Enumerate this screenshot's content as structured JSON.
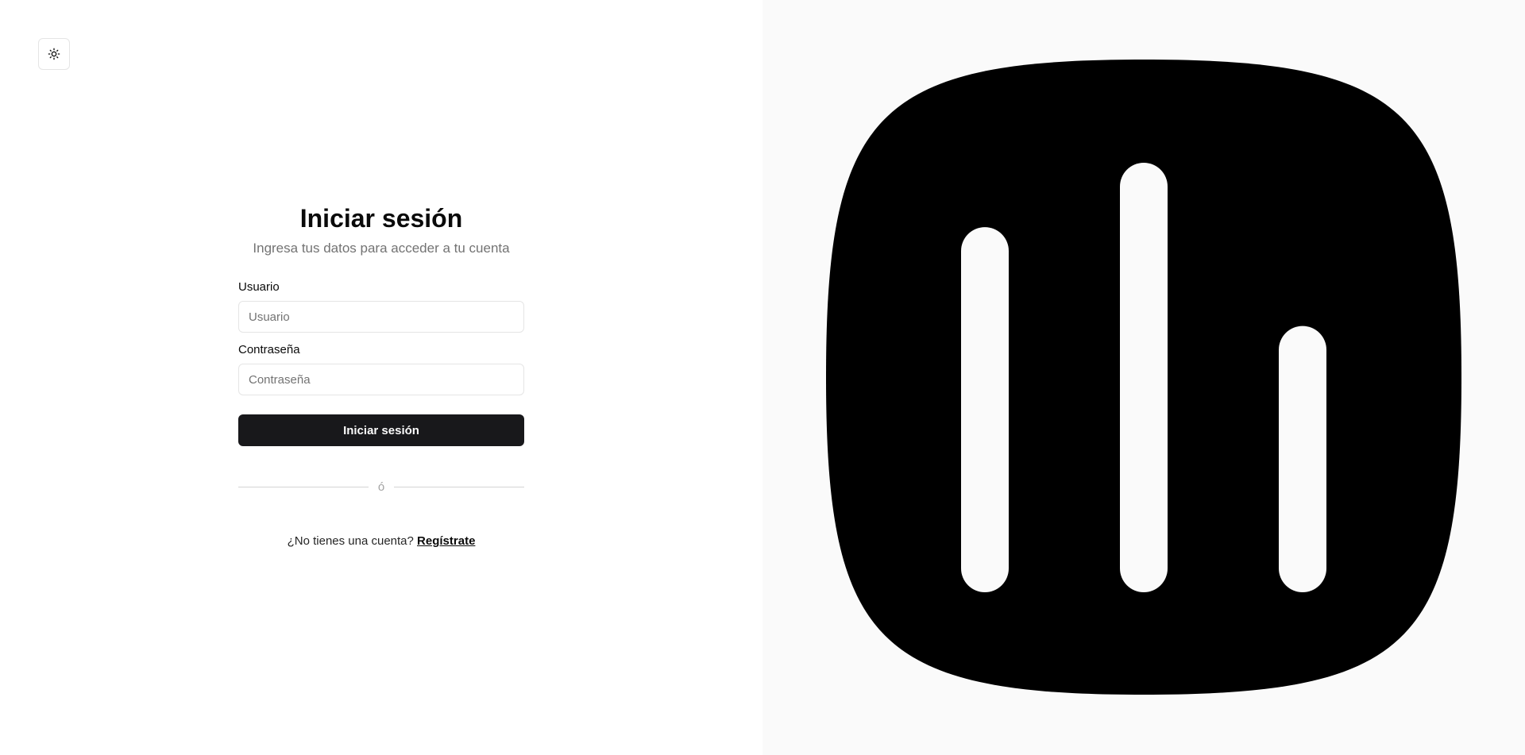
{
  "header": {
    "theme_toggle_icon": "sun-icon"
  },
  "login": {
    "title": "Iniciar sesión",
    "subtitle": "Ingresa tus datos para acceder a tu cuenta",
    "username": {
      "label": "Usuario",
      "placeholder": "Usuario",
      "value": ""
    },
    "password": {
      "label": "Contraseña",
      "placeholder": "Contraseña",
      "value": ""
    },
    "submit_label": "Iniciar sesión",
    "divider_text": "ó",
    "signup_prompt": "¿No tienes una cuenta?",
    "signup_link": "Regístrate"
  },
  "brand": {
    "logo_icon": "bar-chart-logo-icon",
    "logo_color": "#000000",
    "logo_bar_color": "#fafafa",
    "bar_levels": [
      0.85,
      1.0,
      0.62
    ]
  },
  "colors": {
    "primary_button": "#18181b",
    "right_panel_bg": "#fafafa",
    "muted_text": "#737373"
  }
}
